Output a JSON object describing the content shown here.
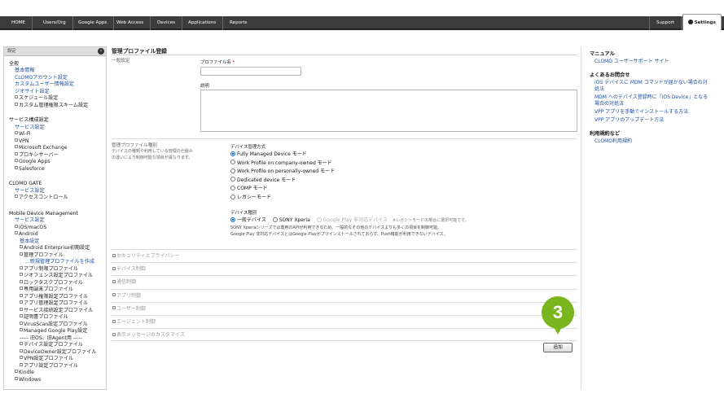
{
  "nav": {
    "tabs": [
      "HOME",
      "Users/Org",
      "Google Apps",
      "Web Access",
      "Devices",
      "Applications",
      "Reports"
    ],
    "support": "Support",
    "settings": "Settings"
  },
  "sidebar": {
    "title": "設定",
    "items": [
      {
        "text": "全般",
        "kind": "h"
      },
      {
        "text": "基本情報",
        "kind": "l",
        "indent": 1
      },
      {
        "text": "CLOMOアカウント設定",
        "kind": "l",
        "indent": 1
      },
      {
        "text": "カスタムユーザー情報設定",
        "kind": "l",
        "indent": 1
      },
      {
        "text": "ジオサイト設定",
        "kind": "l",
        "indent": 1
      },
      {
        "text": "スケジュール設定",
        "kind": "p",
        "indent": 1
      },
      {
        "text": "カスタム管理権限スキーム設定",
        "kind": "p",
        "indent": 1
      },
      {
        "text": "サービス構成設定",
        "kind": "h"
      },
      {
        "text": "サービス設定",
        "kind": "l",
        "indent": 1
      },
      {
        "text": "Wi-Fi",
        "kind": "p",
        "indent": 1
      },
      {
        "text": "VPN",
        "kind": "p",
        "indent": 1
      },
      {
        "text": "Microsoft Exchange",
        "kind": "p",
        "indent": 1
      },
      {
        "text": "プロキシサーバー",
        "kind": "p",
        "indent": 1
      },
      {
        "text": "Google Apps",
        "kind": "p",
        "indent": 1
      },
      {
        "text": "Salesforce",
        "kind": "p",
        "indent": 1
      },
      {
        "text": "CLOMO GATE",
        "kind": "h"
      },
      {
        "text": "サービス設定",
        "kind": "l",
        "indent": 1
      },
      {
        "text": "アクセスコントロール",
        "kind": "p",
        "indent": 1
      },
      {
        "text": "Mobile Device Management",
        "kind": "h"
      },
      {
        "text": "サービス設定",
        "kind": "l",
        "indent": 1
      },
      {
        "text": "iOS/macOS",
        "kind": "p",
        "indent": 1
      },
      {
        "text": "Android",
        "kind": "p",
        "indent": 1
      },
      {
        "text": "基本設定",
        "kind": "l",
        "indent": 2
      },
      {
        "text": "Android Enterprise初期設定",
        "kind": "p",
        "indent": 2
      },
      {
        "text": "管理プロファイル",
        "kind": "p",
        "indent": 2
      },
      {
        "text": "...新規管理プロファイルを作成",
        "kind": "c",
        "indent": 3
      },
      {
        "text": "アプリ制限プロファイル",
        "kind": "p",
        "indent": 2
      },
      {
        "text": "ジオフェンス設定プロファイル",
        "kind": "p",
        "indent": 2
      },
      {
        "text": "ロックタスクプロファイル",
        "kind": "p",
        "indent": 2
      },
      {
        "text": "専用端末プロファイル",
        "kind": "p",
        "indent": 2
      },
      {
        "text": "アプリ権限設定プロファイル",
        "kind": "p",
        "indent": 2
      },
      {
        "text": "アプリ管理設定プロファイル",
        "kind": "p",
        "indent": 2
      },
      {
        "text": "サービス接続設定プロファイル",
        "kind": "p",
        "indent": 2
      },
      {
        "text": "証明書プロファイル",
        "kind": "p",
        "indent": 2
      },
      {
        "text": "VirusScan設定プロファイル",
        "kind": "p",
        "indent": 2
      },
      {
        "text": "Managed Google Play設定",
        "kind": "p",
        "indent": 2
      },
      {
        "text": "----- 旧OS、旧Agent用 -----",
        "kind": "t",
        "indent": 2
      },
      {
        "text": "デバイス設定プロファイル",
        "kind": "p",
        "indent": 2
      },
      {
        "text": "DeviceOwner設定プロファイル",
        "kind": "p",
        "indent": 2
      },
      {
        "text": "VPN設定プロファイル",
        "kind": "p",
        "indent": 2
      },
      {
        "text": "アプリ設定プロファイル",
        "kind": "p",
        "indent": 2
      },
      {
        "text": "Kindle",
        "kind": "p",
        "indent": 1
      },
      {
        "text": "Windows",
        "kind": "p",
        "indent": 1
      }
    ]
  },
  "main": {
    "title": "管理プロファイル登録",
    "general_label": "一般設定",
    "profile_name_label": "プロファイル名",
    "required_mark": "*",
    "profile_name_value": "",
    "description_label": "説明",
    "description_value": "",
    "type_label": "管理プロファイル種別",
    "type_desc": "デバイスの種類や利用している管理の仕組みの違いにより制御可能な項目が異なります。",
    "mode_label": "デバイス管理方式",
    "modes": [
      "Fully Managed Device モード",
      "Work Profile on company-owned モード",
      "Work Profile on personally-owned モード",
      "Dedicated device モード",
      "COMP モード",
      "レガシーモード"
    ],
    "mode_selected": 0,
    "devtype_label": "デバイス種別",
    "devtypes": [
      "一般デバイス",
      "SONY Xperia",
      "Google Play 非対応デバイス"
    ],
    "devtype_note": "※レガシーモードの場合に選択可能です。",
    "notes": [
      "SONY Xperiaシリーズでは専用のAPIが利用できるため、一般的なその他のデバイスよりも多くの項目を制御可能。",
      "Google Play 非対応デバイスとはGoogle Playがプリインストールされておらず、Push機能が利用できないデバイス。"
    ],
    "sections": [
      "セキュリティとプライバシー",
      "デバイス制御",
      "通信制御",
      "アプリ制御",
      "ユーザー制御",
      "エージェント制御",
      "表示メッセージのカスタマイズ"
    ],
    "step_number": "3",
    "add_label": "追加"
  },
  "right": {
    "manual_heading": "マニュアル",
    "manual_link": "CLOMO ユーザーサポート サイト",
    "faq_heading": "よくあるお問合せ",
    "faq_links": [
      "iOS デバイスに MDM コマンドが届かない場合の対",
      "処法",
      "MDM へのデバイス登録時に「iOS Device」となる",
      "場合の対処法",
      "VPP アプリを手動でインストールする方法",
      "VPP アプリのアップデート方法"
    ],
    "terms_heading": "利用規約など",
    "terms_link": "CLOMO利用規約"
  },
  "colors": {
    "accent": "#7ab51d",
    "link": "#1a4fa0",
    "topbar": "#3c3c3c"
  }
}
